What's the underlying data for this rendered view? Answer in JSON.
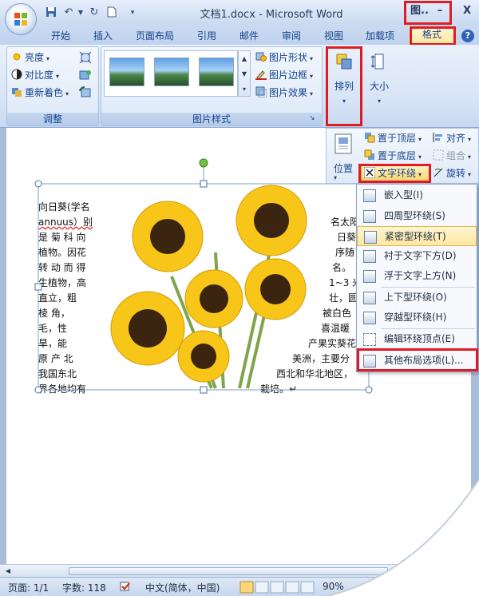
{
  "window": {
    "title": "文档1.docx - Microsoft Word",
    "picture_tools_label": "图..",
    "minimize_label": "–",
    "close_label": "X"
  },
  "quick_access": {
    "save_icon": "save-icon",
    "undo_icon": "undo-icon",
    "redo_icon": "redo-icon",
    "new_icon": "new-document-icon"
  },
  "tabs": [
    "开始",
    "插入",
    "页面布局",
    "引用",
    "邮件",
    "审阅",
    "视图",
    "加载项",
    "格式"
  ],
  "ribbon": {
    "adjust": {
      "label": "调整",
      "brightness": "亮度",
      "contrast": "对比度",
      "recolor": "重新着色"
    },
    "picture_styles": {
      "label": "图片样式",
      "shape": "图片形状",
      "border": "图片边框",
      "effects": "图片效果"
    },
    "arrange": {
      "label": "排列"
    },
    "size": {
      "label": "大小"
    }
  },
  "arrange_panel": {
    "position": "位置",
    "bring_front": "置于顶层",
    "send_back": "置于底层",
    "text_wrap": "文字环绕",
    "align": "对齐",
    "group": "组合",
    "rotate": "旋转"
  },
  "wrap_menu": {
    "items": [
      "嵌入型(I)",
      "四周型环绕(S)",
      "紧密型环绕(T)",
      "衬于文字下方(D)",
      "浮于文字上方(N)",
      "上下型环绕(O)",
      "穿越型环绕(H)",
      "编辑环绕顶点(E)",
      "其他布局选项(L)..."
    ]
  },
  "document": {
    "left_lines": [
      "向日葵(学名",
      "annuus）别",
      "是 菊 科 向",
      "植物。因花",
      "转 动 而 得",
      "生植物，高",
      "直立，粗",
      "棱 角，",
      "毛，性",
      "旱，能",
      "原 产 北",
      "我国东北",
      "界各地均有"
    ],
    "right_lines": [
      "名太阳",
      "日葵",
      "序随",
      "名。",
      "1~3 米",
      "壮，圆",
      "被白色",
      "喜温暖",
      "产果实葵花",
      "美洲，主要分",
      "西北和华北地区，",
      "栽培。↵"
    ]
  },
  "statusbar": {
    "page": "页面: 1/1",
    "words": "字数: 118",
    "language": "中文(简体，中国)",
    "zoom": "90%"
  }
}
